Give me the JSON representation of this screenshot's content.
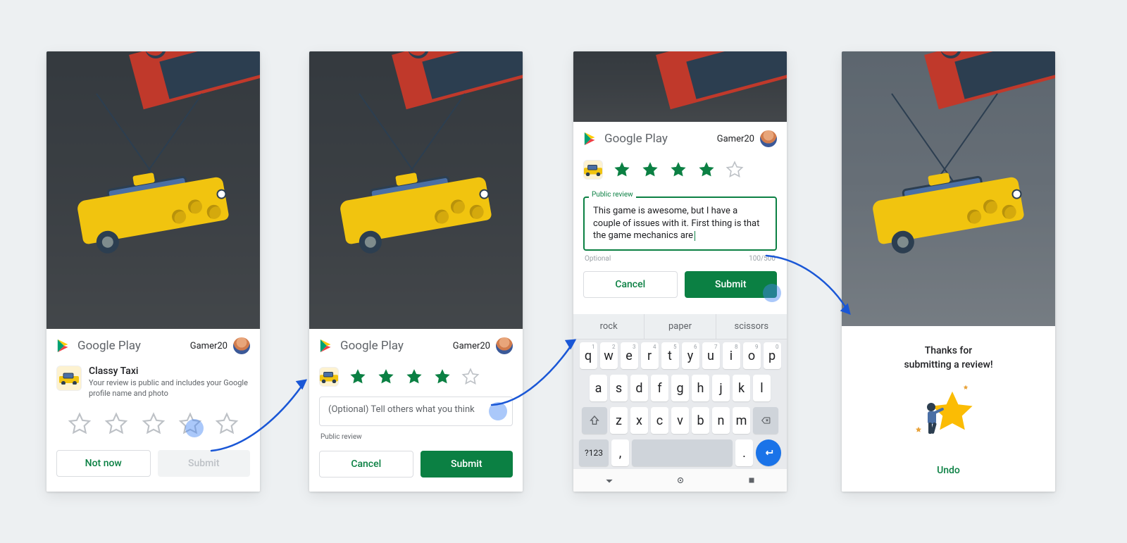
{
  "platform": "Google Play",
  "user": "Gamer20",
  "app": {
    "name": "Classy Taxi"
  },
  "panel1": {
    "disclaimer": "Your review is public and includes your Google profile name and photo",
    "not_now": "Not now",
    "submit": "Submit",
    "rating": 0
  },
  "panel2": {
    "placeholder": "(Optional) Tell others what you think",
    "helper": "Public review",
    "cancel": "Cancel",
    "submit": "Submit",
    "rating": 4
  },
  "panel3": {
    "field_label": "Public review",
    "review_text": "This game is awesome, but I have a couple of issues with it. First thing is that the game mechanics are",
    "helper_left": "Optional",
    "helper_right": "100/500",
    "cancel": "Cancel",
    "submit": "Submit",
    "rating": 4,
    "keyboard": {
      "suggestions": [
        "rock",
        "paper",
        "scissors"
      ],
      "row1": [
        {
          "k": "q",
          "n": "1"
        },
        {
          "k": "w",
          "n": "2"
        },
        {
          "k": "e",
          "n": "3"
        },
        {
          "k": "r",
          "n": "4"
        },
        {
          "k": "t",
          "n": "5"
        },
        {
          "k": "y",
          "n": "6"
        },
        {
          "k": "u",
          "n": "7"
        },
        {
          "k": "i",
          "n": "8"
        },
        {
          "k": "o",
          "n": "9"
        },
        {
          "k": "p",
          "n": "0"
        }
      ],
      "row2": [
        "a",
        "s",
        "d",
        "f",
        "g",
        "h",
        "j",
        "k",
        "l"
      ],
      "row3": [
        "z",
        "x",
        "c",
        "v",
        "b",
        "n",
        "m"
      ],
      "sym": "?123",
      "comma": ",",
      "period": "."
    }
  },
  "panel4": {
    "thanks_line1": "Thanks for",
    "thanks_line2": "submitting a review!",
    "undo": "Undo"
  }
}
